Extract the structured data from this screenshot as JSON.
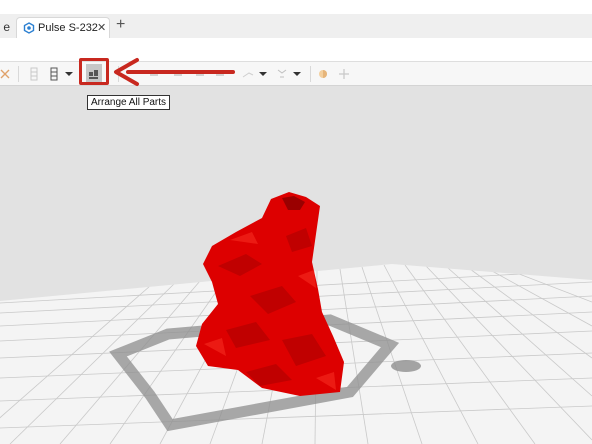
{
  "tabs": {
    "previous_label": "e",
    "active_label": "Pulse S-232",
    "close_glyph": "✕",
    "new_tab_glyph": "+"
  },
  "toolbar": {
    "icons": [
      "close-icon",
      "layer-icon",
      "layer-dropdown-icon",
      "arrange-icon",
      "align-icon",
      "line-tool-icon",
      "support-icon",
      "color-icon",
      "move-icon"
    ]
  },
  "tooltip": {
    "text": "Arrange All Parts"
  },
  "colors": {
    "model": "#e00000",
    "highlight": "#c8281f",
    "plate": "#f4f4f4",
    "background": "#e2e2e2"
  }
}
